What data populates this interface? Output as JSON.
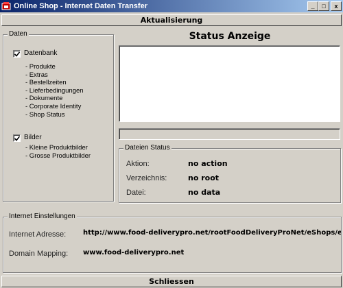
{
  "window": {
    "title": "Online Shop - Internet Daten Transfer",
    "minimize_glyph": "_",
    "maximize_glyph": "□",
    "close_glyph": "x"
  },
  "toolbar": {
    "update_label": "Aktualisierung"
  },
  "daten": {
    "legend": "Daten",
    "datenbank": {
      "label": "Datenbank",
      "checked": true,
      "items": [
        "- Produkte",
        "- Extras",
        "- Bestellzeiten",
        "- Lieferbedingungen",
        "- Dokumente",
        "- Corporate Identity",
        "- Shop Status"
      ]
    },
    "bilder": {
      "label": "Bilder",
      "checked": true,
      "items": [
        "- Kleine Produktbilder",
        "- Grosse Produktbilder"
      ]
    }
  },
  "status": {
    "title": "Status Anzeige",
    "log_text": "",
    "progress": 0
  },
  "dateien_status": {
    "legend": "Dateien Status",
    "aktion_label": "Aktion:",
    "aktion_value": "no action",
    "verzeichnis_label": "Verzeichnis:",
    "verzeichnis_value": "no root",
    "datei_label": "Datei:",
    "datei_value": "no data"
  },
  "internet": {
    "legend": "Internet Einstellungen",
    "adresse_label": "Internet Adresse:",
    "adresse_value": "http://www.food-deliverypro.net/rootFoodDeliveryProNet/eShops/e_MyShop/",
    "mapping_label": "Domain Mapping:",
    "mapping_value": "www.food-deliverypro.net"
  },
  "footer": {
    "close_label": "Schliessen"
  }
}
